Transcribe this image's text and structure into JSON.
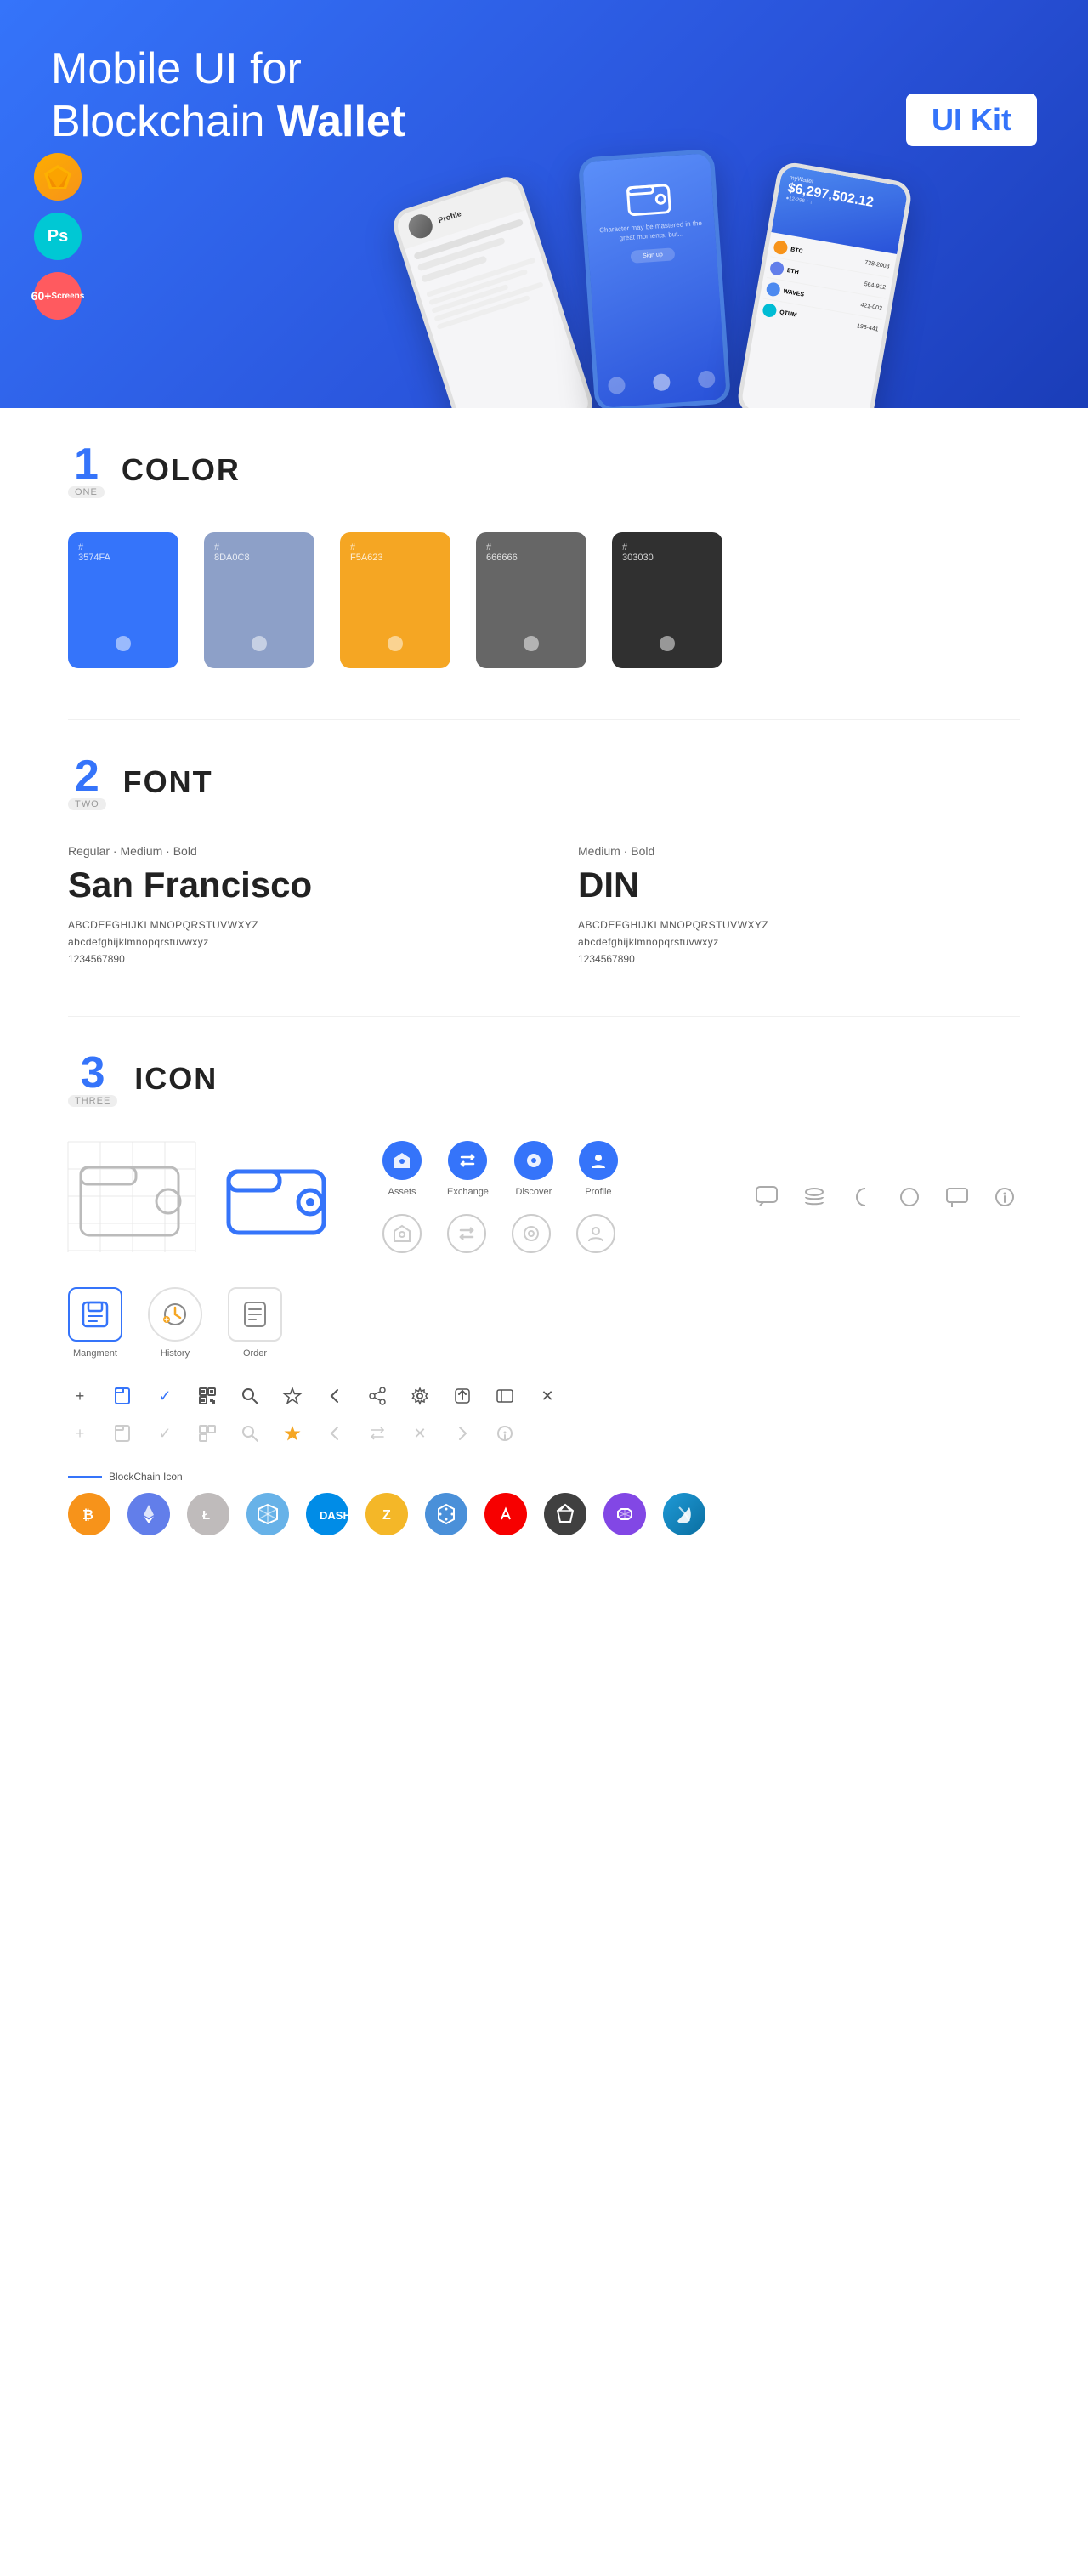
{
  "hero": {
    "title_light": "Mobile UI for Blockchain ",
    "title_bold": "Wallet",
    "badge": "UI Kit",
    "sketch_label": "Sketch",
    "ps_label": "Ps",
    "screens_label": "60+\nScreens"
  },
  "sections": {
    "color": {
      "number": "1",
      "word": "ONE",
      "title": "COLOR",
      "swatches": [
        {
          "hex": "#3574FA",
          "label": "#\n3574FA",
          "dot_opacity": 0.5
        },
        {
          "hex": "#8DA0C8",
          "label": "#\n8DA0C8",
          "dot_opacity": 0.5
        },
        {
          "hex": "#F5A623",
          "label": "#\nF5A623",
          "dot_opacity": 0.5
        },
        {
          "hex": "#666666",
          "label": "#\n666666",
          "dot_opacity": 0.5
        },
        {
          "hex": "#303030",
          "label": "#\n303030",
          "dot_opacity": 0.5
        }
      ]
    },
    "font": {
      "number": "2",
      "word": "TWO",
      "title": "FONT",
      "font1": {
        "style": "Regular · Medium · Bold",
        "name": "San Francisco",
        "upper": "ABCDEFGHIJKLMNOPQRSTUVWXYZ",
        "lower": "abcdefghijklmnopqrstuvwxyz",
        "numbers": "1234567890"
      },
      "font2": {
        "style": "Medium · Bold",
        "name": "DIN",
        "upper": "ABCDEFGHIJKLMNOPQRSTUVWXYZ",
        "lower": "abcdefghijklmnopqrstuvwxyz",
        "numbers": "1234567890"
      }
    },
    "icon": {
      "number": "3",
      "word": "THREE",
      "title": "ICON",
      "nav_icons": [
        {
          "label": "Assets",
          "filled": true
        },
        {
          "label": "Exchange",
          "filled": true
        },
        {
          "label": "Discover",
          "filled": true
        },
        {
          "label": "Profile",
          "filled": true
        }
      ],
      "app_icons": [
        {
          "label": "Mangment"
        },
        {
          "label": "History"
        },
        {
          "label": "Order"
        }
      ],
      "blockchain_label": "BlockChain Icon",
      "crypto_coins": [
        {
          "label": "BTC",
          "color": "#F7931A"
        },
        {
          "label": "ETH",
          "color": "#627EEA"
        },
        {
          "label": "LTC",
          "color": "#BFBBBB"
        },
        {
          "label": "XEM",
          "color": "#67B2E8"
        },
        {
          "label": "DASH",
          "color": "#008CE7"
        },
        {
          "label": "ZEC",
          "color": "#F4B728"
        },
        {
          "label": "NET",
          "color": "#4A90D9"
        },
        {
          "label": "ARK",
          "color": "#F70000"
        },
        {
          "label": "GEM",
          "color": "#404040"
        },
        {
          "label": "POL",
          "color": "#8247E5"
        }
      ]
    }
  }
}
